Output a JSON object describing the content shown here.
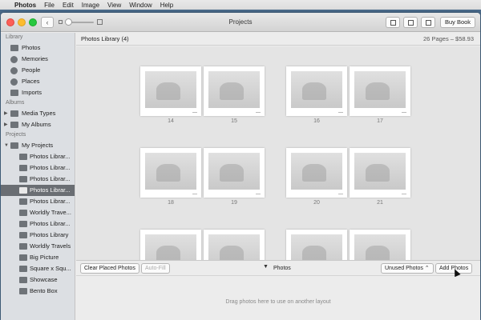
{
  "menubar": {
    "apple": "",
    "app": "Photos",
    "items": [
      "File",
      "Edit",
      "Image",
      "View",
      "Window",
      "Help"
    ]
  },
  "window": {
    "title": "Projects",
    "back_glyph": "‹",
    "buy_book": "Buy Book"
  },
  "sidebar": {
    "library_header": "Library",
    "library_items": [
      "Photos",
      "Memories",
      "People",
      "Places",
      "Imports"
    ],
    "albums_header": "Albums",
    "album_items": [
      "Media Types",
      "My Albums"
    ],
    "projects_header": "Projects",
    "project_root": "My Projects",
    "project_items": [
      "Photos Librar...",
      "Photos Librar...",
      "Photos Librar...",
      "Photos Librar...",
      "Photos Librar...",
      "Worldly Trave...",
      "Photos Librar...",
      "Photos Library",
      "Worldly Travels",
      "Big Picture",
      "Square x Squ...",
      "Showcase",
      "Bento Box"
    ],
    "selected_index": 3
  },
  "main": {
    "library_title": "Photos Library (4)",
    "library_meta": "26 Pages – $58.93",
    "page_numbers": [
      "14",
      "15",
      "16",
      "17",
      "18",
      "19",
      "20",
      "21"
    ]
  },
  "bottom": {
    "clear_button": "Clear Placed Photos",
    "autofill_button": "Auto-Fill",
    "photos_label": "Photos",
    "unused_select": "Unused Photos ⌃",
    "add_button": "Add Photos",
    "tray_hint": "Drag photos here to use on another layout"
  }
}
